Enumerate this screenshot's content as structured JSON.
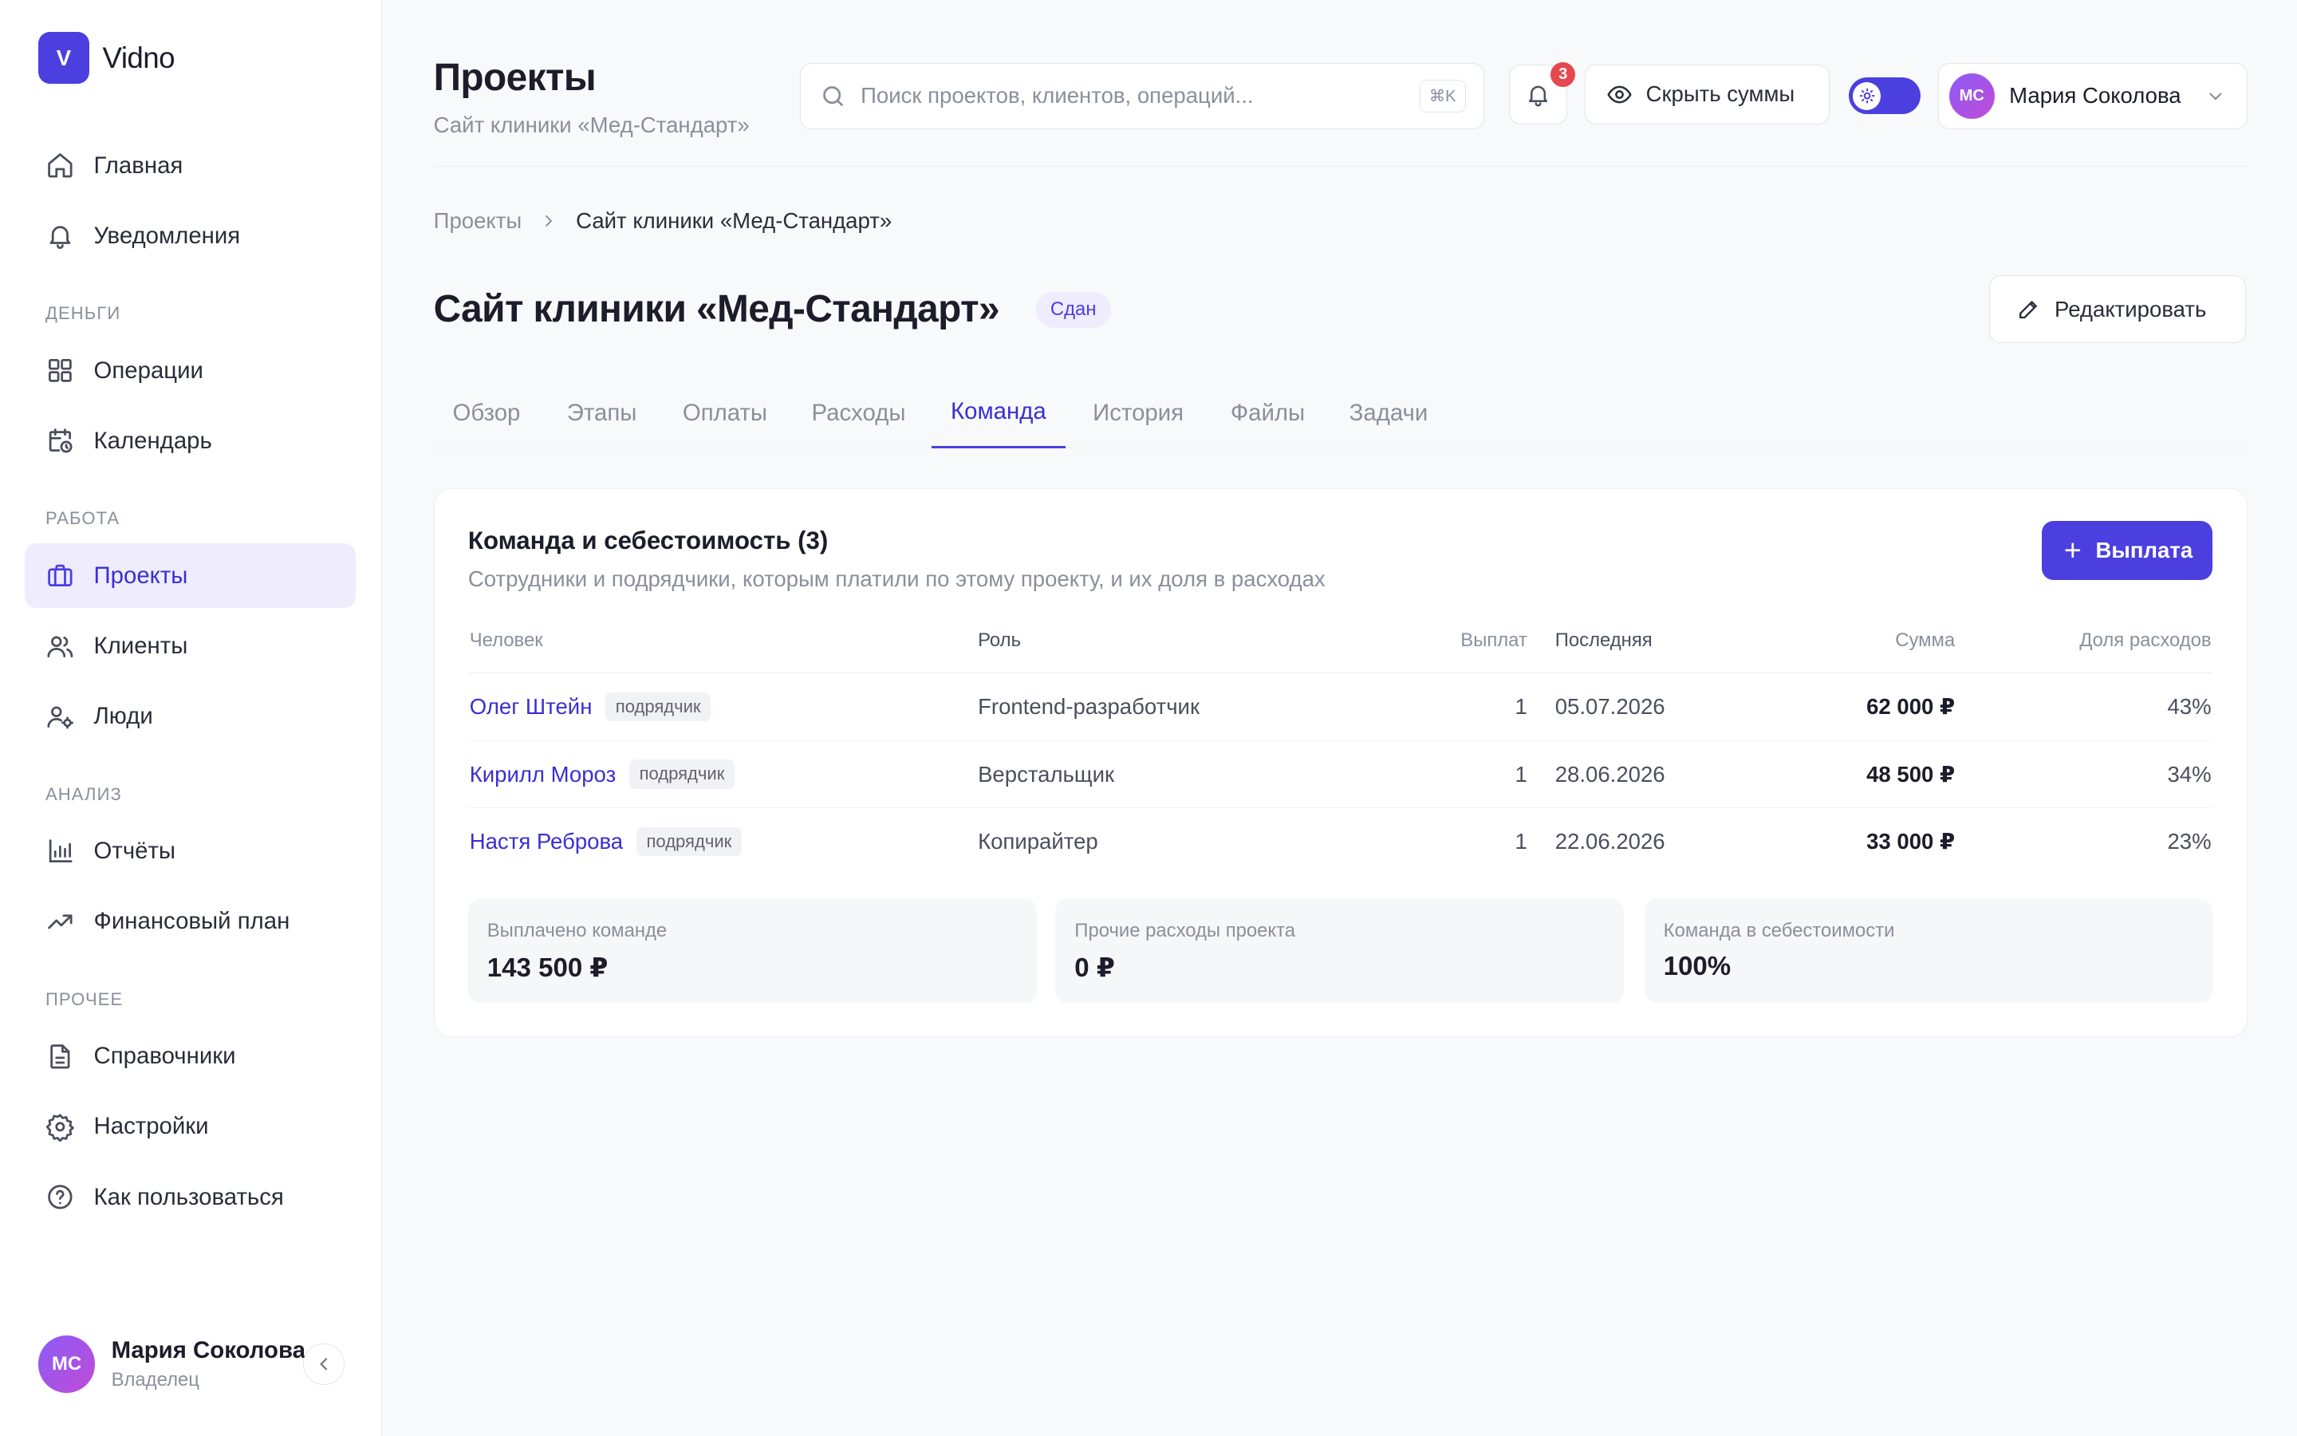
{
  "app": {
    "logo_letter": "V",
    "name": "Vidno"
  },
  "sidebar": {
    "top_items": [
      {
        "label": "Главная",
        "icon": "home-icon"
      },
      {
        "label": "Уведомления",
        "icon": "bell-icon"
      }
    ],
    "sections": [
      {
        "title": "Деньги",
        "items": [
          {
            "label": "Операции",
            "icon": "grid-icon"
          },
          {
            "label": "Календарь",
            "icon": "calendar-clock-icon"
          }
        ]
      },
      {
        "title": "Работа",
        "items": [
          {
            "label": "Проекты",
            "icon": "briefcase-icon",
            "active": true
          },
          {
            "label": "Клиенты",
            "icon": "users-icon"
          },
          {
            "label": "Люди",
            "icon": "user-gear-icon"
          }
        ]
      },
      {
        "title": "Анализ",
        "items": [
          {
            "label": "Отчёты",
            "icon": "bar-chart-icon"
          },
          {
            "label": "Финансовый план",
            "icon": "trending-up-icon"
          }
        ]
      },
      {
        "title": "Прочее",
        "items": [
          {
            "label": "Справочники",
            "icon": "document-icon"
          },
          {
            "label": "Настройки",
            "icon": "gear-icon"
          },
          {
            "label": "Как пользоваться",
            "icon": "help-circle-icon"
          }
        ]
      }
    ],
    "user": {
      "initials": "МС",
      "name": "Мария Соколова",
      "role": "Владелец"
    }
  },
  "header": {
    "title": "Проекты",
    "subtitle": "Сайт клиники «Мед-Стандарт»",
    "search_placeholder": "Поиск проектов, клиентов, операций...",
    "search_shortcut": "⌘K",
    "notifications_count": "3",
    "hide_sums_label": "Скрыть суммы",
    "user_initials": "МС",
    "user_name": "Мария Соколова"
  },
  "breadcrumb": {
    "parent": "Проекты",
    "current": "Сайт клиники «Мед-Стандарт»"
  },
  "project": {
    "title": "Сайт клиники «Мед-Стандарт»",
    "status": "Сдан",
    "edit_label": "Редактировать"
  },
  "tabs": [
    "Обзор",
    "Этапы",
    "Оплаты",
    "Расходы",
    "Команда",
    "История",
    "Файлы",
    "Задачи"
  ],
  "active_tab": "Команда",
  "team": {
    "title": "Команда и себестоимость (3)",
    "subtitle": "Сотрудники и подрядчики, которым платили по этому проекту, и их доля в расходах",
    "pay_button": "Выплата",
    "columns": {
      "person": "Человек",
      "role": "Роль",
      "count": "Выплат",
      "last": "Последняя",
      "sum": "Сумма",
      "share": "Доля расходов"
    },
    "rows": [
      {
        "name": "Олег Штейн",
        "tag": "подрядчик",
        "role": "Frontend-разработчик",
        "count": "1",
        "last": "05.07.2026",
        "sum": "62 000 ₽",
        "share": "43%"
      },
      {
        "name": "Кирилл Мороз",
        "tag": "подрядчик",
        "role": "Верстальщик",
        "count": "1",
        "last": "28.06.2026",
        "sum": "48 500 ₽",
        "share": "34%"
      },
      {
        "name": "Настя Реброва",
        "tag": "подрядчик",
        "role": "Копирайтер",
        "count": "1",
        "last": "22.06.2026",
        "sum": "33 000 ₽",
        "share": "23%"
      }
    ],
    "stats": [
      {
        "label": "Выплачено команде",
        "value": "143 500 ₽"
      },
      {
        "label": "Прочие расходы проекта",
        "value": "0 ₽"
      },
      {
        "label": "Команда в себестоимости",
        "value": "100%"
      }
    ]
  },
  "colors": {
    "accent": "#4b3fe0",
    "badge": "#e5484d",
    "muted": "#8a8f9b"
  }
}
